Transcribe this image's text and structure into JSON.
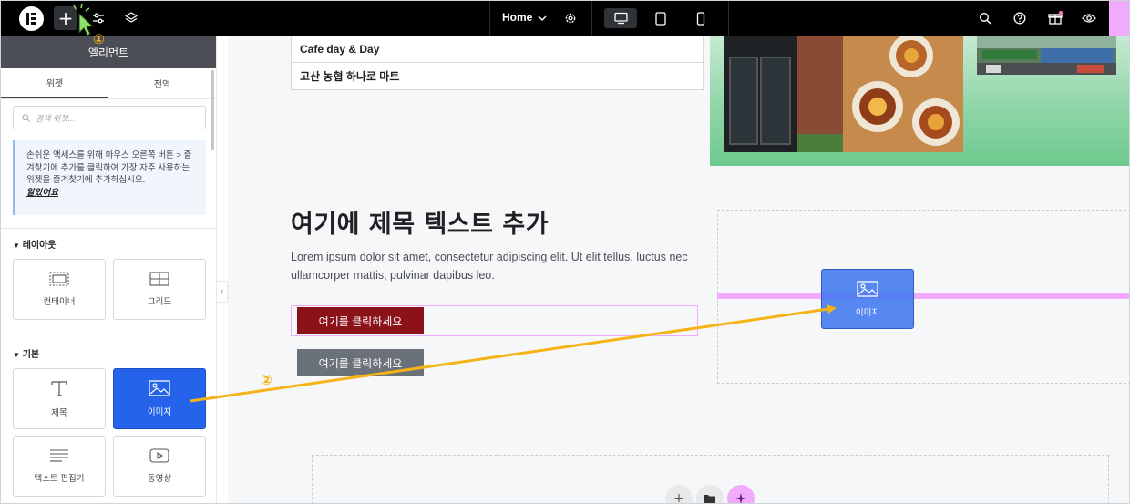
{
  "topbar": {
    "page_label": "Home",
    "icons": [
      "elementor-logo-icon",
      "plus-icon",
      "sliders-icon",
      "layers-icon",
      "chevron-down-icon",
      "gear-icon",
      "desktop-icon",
      "tablet-icon",
      "mobile-icon",
      "search-icon",
      "help-icon",
      "gift-icon",
      "eye-icon"
    ]
  },
  "sidebar": {
    "title": "엘리먼트",
    "tabs": [
      "위젯",
      "전역"
    ],
    "search_placeholder": "검색 위젯...",
    "notice": {
      "text": "손쉬운 액세스를 위해 마우스 오른쪽 버튼 > 즐겨찾기에 추가를 클릭하여 가장 자주 사용하는 위젯을 즐겨찾기에 추가하십시오.",
      "ok": "알았어요"
    },
    "section_layout": "레이아웃",
    "section_basic": "기본",
    "widgets": [
      {
        "label": "컨테이너",
        "icon": "container-icon"
      },
      {
        "label": "그리드",
        "icon": "grid-icon"
      },
      {
        "label": "제목",
        "icon": "heading-icon"
      },
      {
        "label": "이미지",
        "icon": "image-icon"
      },
      {
        "label": "텍스트 편집기",
        "icon": "text-editor-icon"
      },
      {
        "label": "동영상",
        "icon": "video-icon"
      }
    ]
  },
  "canvas": {
    "table_rows": [
      "Cafe day & Day",
      "고산 농협 하나로 마트"
    ],
    "heading": "여기에 제목 텍스트 추가",
    "paragraph": "Lorem ipsum dolor sit amet, consectetur adipiscing elit. Ut elit tellus, luctus nec ullamcorper mattis, pulvinar dapibus leo.",
    "button_primary": "여기를 클릭하세요",
    "button_secondary": "여기를 클릭하세요",
    "drag_label": "이미지"
  },
  "annotations": {
    "step1": "①",
    "step2": "②",
    "color": "#f5b316"
  },
  "colors": {
    "accent_blue": "#2563eb",
    "drop_indicator": "#f0abfc",
    "button_primary": "#8b1219",
    "button_secondary": "#6b7179"
  }
}
